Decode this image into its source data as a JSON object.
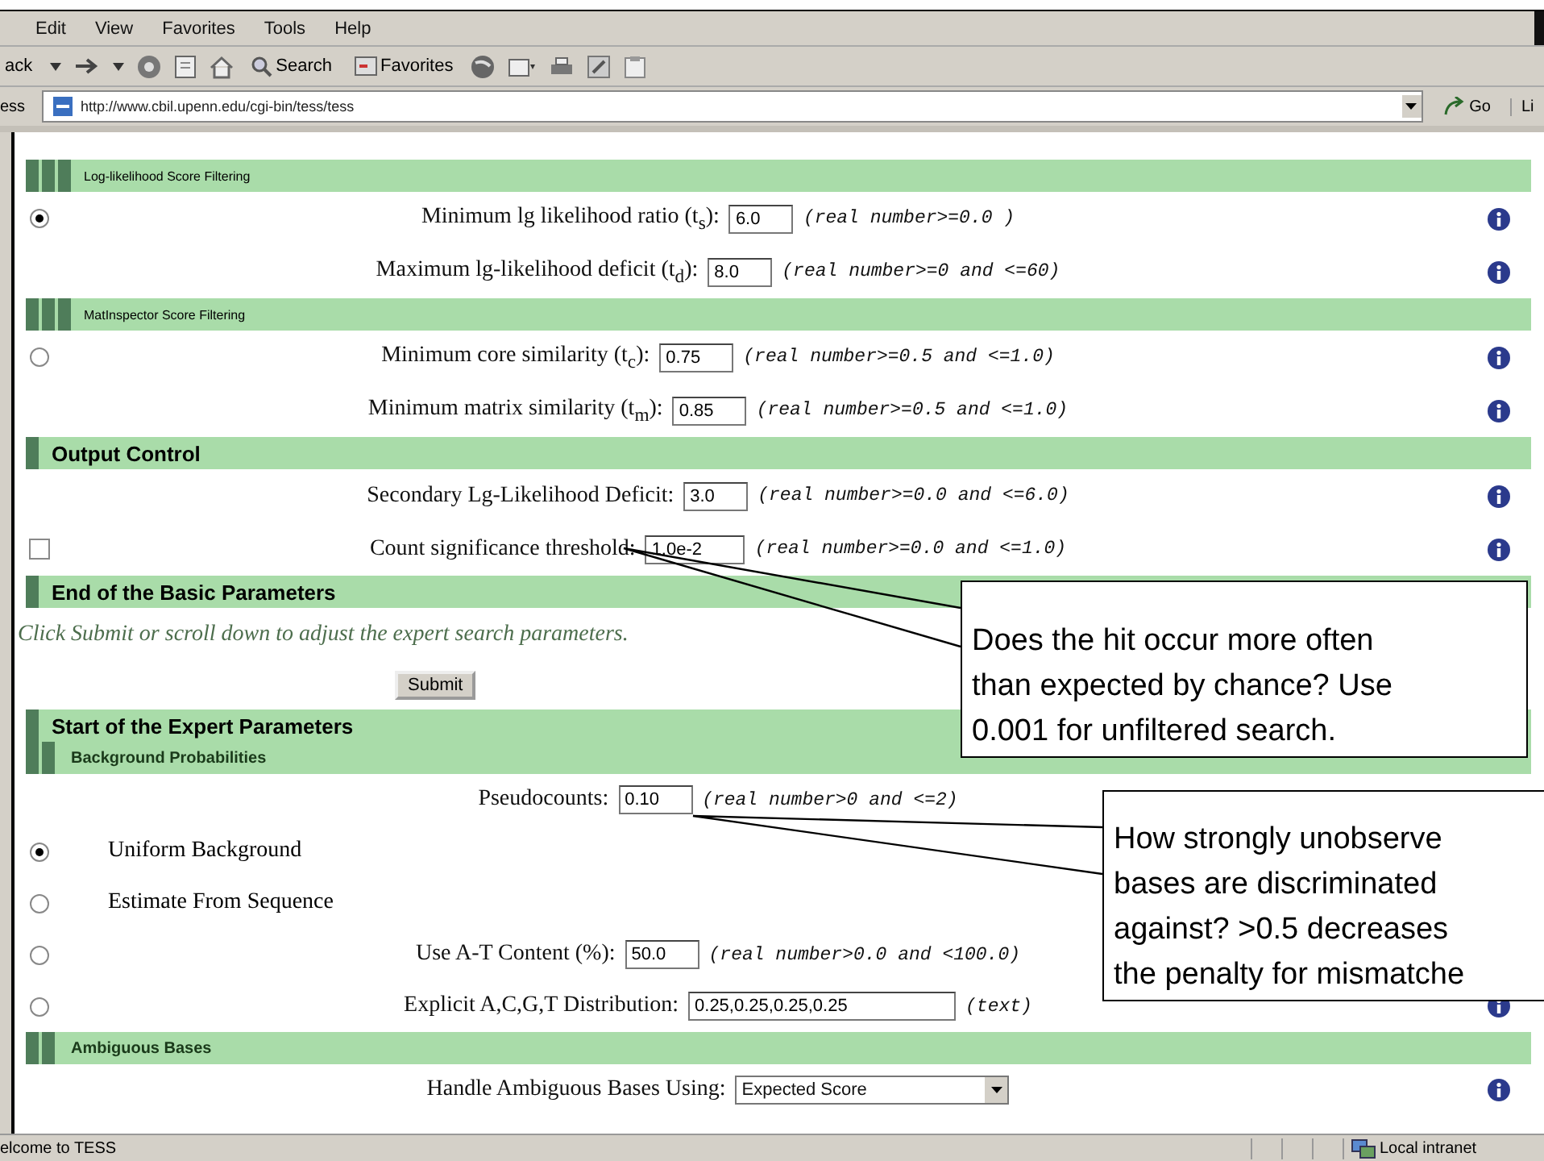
{
  "menu_bar": [
    "Edit",
    "View",
    "Favorites",
    "Tools",
    "Help"
  ],
  "toolbar": {
    "back_label": "ack",
    "search_label": "Search",
    "favorites_label": "Favorites"
  },
  "address_bar": {
    "label": "ess",
    "url": "http://www.cbil.upenn.edu/cgi-bin/tess/tess",
    "go_label": "Go",
    "links_label": "Li"
  },
  "sections": [
    {
      "title": "Log-likelihood Score Filtering",
      "kind": "minor",
      "rows": [
        {
          "kind": "radio_field",
          "selected": true,
          "label": "Minimum lg likelihood ratio (t$_{s}$):",
          "value": "6.0",
          "hint": "(real number>=0.0 )",
          "info": true
        },
        {
          "kind": "field",
          "label": "Maximum lg-likelihood deficit (t$_{d}$):",
          "value": "8.0",
          "hint": "(real number>=0 and <=60)",
          "info": true
        }
      ]
    },
    {
      "title": "MatInspector Score Filtering",
      "kind": "minor",
      "rows": [
        {
          "kind": "radio_field",
          "selected": false,
          "label": "Minimum core similarity (t$_{c}$):",
          "value": "0.75",
          "hint": "(real number>=0.5 and <=1.0)",
          "info": true
        },
        {
          "kind": "field",
          "label": "Minimum matrix similarity (t$_{m}$):",
          "value": "0.85",
          "hint": "(real number>=0.5 and <=1.0)",
          "info": true
        }
      ]
    },
    {
      "title": "Output Control",
      "kind": "major",
      "rows": [
        {
          "kind": "field",
          "label": "Secondary Lg-Likelihood Deficit:",
          "value": "3.0",
          "hint": "(real number>=0.0 and <=6.0)",
          "info": true
        },
        {
          "kind": "checkbox_field",
          "checked": false,
          "label": "Count significance threshold:",
          "value": "1.0e-2",
          "hint": "(real number>=0.0 and <=1.0)",
          "info": true
        }
      ]
    },
    {
      "title": "End of the Basic Parameters",
      "kind": "major",
      "rows": [
        {
          "kind": "note",
          "label": "Click Submit or scroll down to adjust the expert search parameters."
        },
        {
          "kind": "submit",
          "label": "Submit"
        }
      ]
    },
    {
      "title": "Start of the Expert Parameters",
      "kind": "major"
    },
    {
      "title": "Background Probabilities",
      "kind": "sub",
      "rows": [
        {
          "kind": "field",
          "label": "Pseudocounts:",
          "value": "0.10",
          "hint": "(real number>0 and <=2)",
          "info": false
        },
        {
          "kind": "radio_option",
          "selected": true,
          "label": "Uniform Background"
        },
        {
          "kind": "radio_option",
          "selected": false,
          "label": "Estimate From Sequence"
        },
        {
          "kind": "radio_field",
          "selected": false,
          "label": "Use A-T Content (%):",
          "value": "50.0",
          "hint": "(real number>0.0 and <100.0)",
          "info": false
        },
        {
          "kind": "radio_field",
          "selected": false,
          "label": "Explicit A,C,G,T Distribution:",
          "value": "0.25,0.25,0.25,0.25",
          "hint": "(text)",
          "info": true
        }
      ]
    },
    {
      "title": "Ambiguous Bases",
      "kind": "sub",
      "rows": [
        {
          "kind": "select",
          "label": "Handle Ambiguous Bases Using:",
          "value": "Expected Score",
          "info": true
        }
      ]
    }
  ],
  "callouts": [
    {
      "text": "Does the hit occur more often\nthan expected by chance? Use\n0.001 for unfiltered search."
    },
    {
      "text": "How strongly unobserve\nbases are discriminated\nagainst? >0.5 decreases\nthe penalty for mismatche"
    }
  ],
  "status_bar": {
    "message": "elcome to TESS",
    "zone": "Local intranet"
  }
}
